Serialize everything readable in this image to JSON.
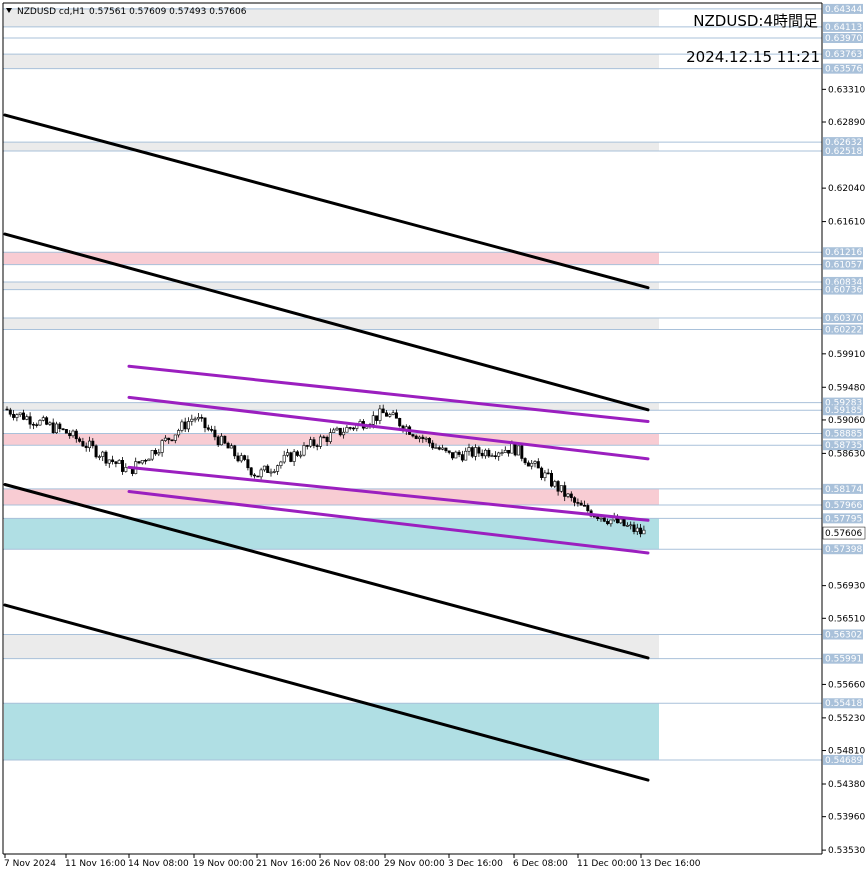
{
  "chart_data": {
    "type": "candlestick",
    "header": {
      "symbol": "NZDUSD cd,H1",
      "ohlc": "0.57561 0.57609 0.57493 0.57606"
    },
    "title": "NZDUSD:4時間足",
    "timestamp": "2024.12.15 11:21",
    "ylim": [
      0.5348,
      0.6442
    ],
    "current_price": "0.57606",
    "y_ticks": [
      "0.63310",
      "0.62890",
      "0.62040",
      "0.61610",
      "0.59910",
      "0.59480",
      "0.59060",
      "0.58630",
      "0.56930",
      "0.56510",
      "0.55660",
      "0.55230",
      "0.54810",
      "0.54380",
      "0.53960",
      "0.53530"
    ],
    "price_levels": [
      {
        "label": "0.64344",
        "value": 0.64344
      },
      {
        "label": "0.64113",
        "value": 0.64113
      },
      {
        "label": "0.63970",
        "value": 0.6397
      },
      {
        "label": "0.63763",
        "value": 0.63763
      },
      {
        "label": "0.63576",
        "value": 0.63576
      },
      {
        "label": "0.62632",
        "value": 0.62632
      },
      {
        "label": "0.62518",
        "value": 0.62518
      },
      {
        "label": "0.61216",
        "value": 0.61216
      },
      {
        "label": "0.61057",
        "value": 0.61057
      },
      {
        "label": "0.60834",
        "value": 0.60834
      },
      {
        "label": "0.60736",
        "value": 0.60736
      },
      {
        "label": "0.60370",
        "value": 0.6037
      },
      {
        "label": "0.60222",
        "value": 0.60222
      },
      {
        "label": "0.59283",
        "value": 0.59283
      },
      {
        "label": "0.59185",
        "value": 0.59185
      },
      {
        "label": "0.58885",
        "value": 0.58885
      },
      {
        "label": "0.58735",
        "value": 0.58735
      },
      {
        "label": "0.58174",
        "value": 0.58174
      },
      {
        "label": "0.57966",
        "value": 0.57966
      },
      {
        "label": "0.57795",
        "value": 0.57795
      },
      {
        "label": "0.57398",
        "value": 0.57398
      },
      {
        "label": "0.56302",
        "value": 0.56302
      },
      {
        "label": "0.55991",
        "value": 0.55991
      },
      {
        "label": "0.55418",
        "value": 0.55418
      },
      {
        "label": "0.54689",
        "value": 0.54689
      }
    ],
    "zones": [
      {
        "from": 0.64344,
        "to": 0.64113,
        "color": "#ebebeb"
      },
      {
        "from": 0.6397,
        "to": 0.63763,
        "color": "#ffffff"
      },
      {
        "from": 0.63763,
        "to": 0.63576,
        "color": "#ebebeb"
      },
      {
        "from": 0.62632,
        "to": 0.62518,
        "color": "#ebebeb"
      },
      {
        "from": 0.61216,
        "to": 0.61057,
        "color": "#f8ccd3"
      },
      {
        "from": 0.60834,
        "to": 0.60736,
        "color": "#ebebeb"
      },
      {
        "from": 0.6037,
        "to": 0.60222,
        "color": "#ebebeb"
      },
      {
        "from": 0.59283,
        "to": 0.59185,
        "color": "#ebebeb"
      },
      {
        "from": 0.58885,
        "to": 0.58735,
        "color": "#f8ccd3"
      },
      {
        "from": 0.58174,
        "to": 0.57966,
        "color": "#f8ccd3"
      },
      {
        "from": 0.57795,
        "to": 0.57398,
        "color": "#b0dfe4"
      },
      {
        "from": 0.56302,
        "to": 0.55991,
        "color": "#ebebeb"
      },
      {
        "from": 0.55418,
        "to": 0.54689,
        "color": "#b0dfe4"
      }
    ],
    "x_ticks": [
      "7 Nov 2024",
      "11 Nov 16:00",
      "14 Nov 08:00",
      "19 Nov 00:00",
      "21 Nov 16:00",
      "26 Nov 08:00",
      "29 Nov 00:00",
      "3 Dec 16:00",
      "6 Dec 08:00",
      "11 Dec 00:00",
      "13 Dec 16:00"
    ],
    "trend_lines": [
      {
        "name": "black-channel-1",
        "color": "#000000",
        "start": [
          "7 Nov 2024",
          0.6298
        ],
        "end": [
          "13 Dec 16:00",
          0.6076
        ]
      },
      {
        "name": "black-channel-2",
        "color": "#000000",
        "start": [
          "7 Nov 2024",
          0.6145
        ],
        "end": [
          "13 Dec 16:00",
          0.5919
        ]
      },
      {
        "name": "black-channel-3",
        "color": "#000000",
        "start": [
          "7 Nov 2024",
          0.5823
        ],
        "end": [
          "13 Dec 16:00",
          0.56
        ]
      },
      {
        "name": "black-channel-4",
        "color": "#000000",
        "start": [
          "7 Nov 2024",
          0.5668
        ],
        "end": [
          "13 Dec 16:00",
          0.5443
        ]
      },
      {
        "name": "purple-channel-1",
        "color": "#9b1fbf",
        "start": [
          "14 Nov 08:00",
          0.5975
        ],
        "end": [
          "13 Dec 16:00",
          0.5904
        ]
      },
      {
        "name": "purple-channel-2",
        "color": "#9b1fbf",
        "start": [
          "14 Nov 08:00",
          0.5935
        ],
        "end": [
          "13 Dec 16:00",
          0.5856
        ]
      },
      {
        "name": "purple-channel-3",
        "color": "#9b1fbf",
        "start": [
          "14 Nov 08:00",
          0.5845
        ],
        "end": [
          "13 Dec 16:00",
          0.5777
        ]
      },
      {
        "name": "purple-channel-4",
        "color": "#9b1fbf",
        "start": [
          "14 Nov 08:00",
          0.5814
        ],
        "end": [
          "13 Dec 16:00",
          0.5735
        ]
      }
    ],
    "price_path": [
      {
        "x": "7 Nov 2024",
        "y": 0.592
      },
      {
        "x": "11 Nov 16:00",
        "y": 0.589
      },
      {
        "x": "14 Nov 08:00",
        "y": 0.584
      },
      {
        "x": "19 Nov 00:00",
        "y": 0.591
      },
      {
        "x": "21 Nov 16:00",
        "y": 0.5835
      },
      {
        "x": "26 Nov 08:00",
        "y": 0.588
      },
      {
        "x": "29 Nov 00:00",
        "y": 0.5915
      },
      {
        "x": "3 Dec 16:00",
        "y": 0.586
      },
      {
        "x": "6 Dec 08:00",
        "y": 0.587
      },
      {
        "x": "11 Dec 00:00",
        "y": 0.5795
      },
      {
        "x": "13 Dec 16:00",
        "y": 0.5761
      }
    ],
    "grid": false,
    "legend": "none"
  }
}
